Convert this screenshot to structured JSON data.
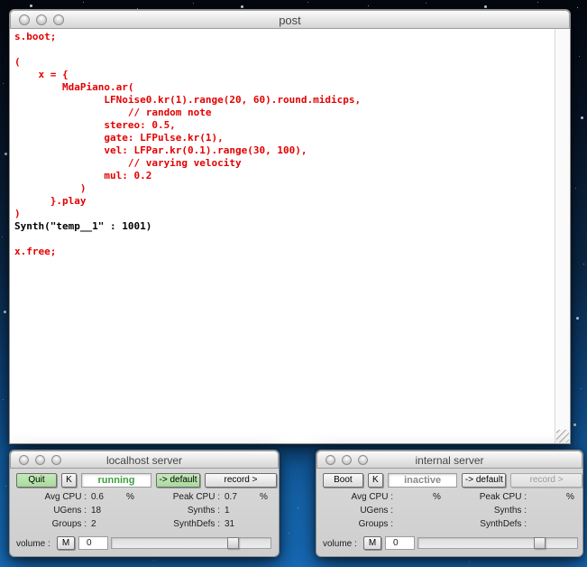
{
  "post_window": {
    "title": "post",
    "code_lines": [
      {
        "text": "s.boot;"
      },
      {
        "text": ""
      },
      {
        "text": "("
      },
      {
        "text": "    x = {"
      },
      {
        "text": "        MdaPiano.ar("
      },
      {
        "text": "               LFNoise0.kr(1).range(20, 60).round.midicps,"
      },
      {
        "text": "                   // random note"
      },
      {
        "text": "               stereo: 0.5,"
      },
      {
        "text": "               gate: LFPulse.kr(1),"
      },
      {
        "text": "               vel: LFPar.kr(0.1).range(30, 100),"
      },
      {
        "text": "                   // varying velocity"
      },
      {
        "text": "               mul: 0.2"
      },
      {
        "text": "           )"
      },
      {
        "text": "      }.play"
      },
      {
        "text": ")"
      },
      {
        "text": "Synth(\"temp__1\" : 1001)"
      },
      {
        "text": ""
      },
      {
        "text": "x.free;"
      }
    ]
  },
  "localhost_server": {
    "title": "localhost server",
    "buttons": {
      "power": "Quit",
      "kill": "K",
      "status": "running",
      "default": "-> default",
      "record": "record >"
    },
    "stats": [
      {
        "l_label": "Avg CPU :",
        "l_value": "0.6",
        "l_pct": "%",
        "r_label": "Peak CPU :",
        "r_value": "0.7",
        "r_pct": "%"
      },
      {
        "l_label": "UGens :",
        "l_value": "18",
        "l_pct": "",
        "r_label": "Synths :",
        "r_value": "1",
        "r_pct": ""
      },
      {
        "l_label": "Groups :",
        "l_value": "2",
        "l_pct": "",
        "r_label": "SynthDefs :",
        "r_value": "31",
        "r_pct": ""
      }
    ],
    "volume": {
      "label": "volume :",
      "mute": "M",
      "value": "0"
    }
  },
  "internal_server": {
    "title": "internal server",
    "buttons": {
      "power": "Boot",
      "kill": "K",
      "status": "inactive",
      "default": "-> default",
      "record": "record >"
    },
    "stats": [
      {
        "l_label": "Avg CPU :",
        "l_value": "",
        "l_pct": "%",
        "r_label": "Peak CPU :",
        "r_value": "",
        "r_pct": "%"
      },
      {
        "l_label": "UGens :",
        "l_value": "",
        "l_pct": "",
        "r_label": "Synths :",
        "r_value": "",
        "r_pct": ""
      },
      {
        "l_label": "Groups :",
        "l_value": "",
        "l_pct": "",
        "r_label": "SynthDefs :",
        "r_value": "",
        "r_pct": ""
      }
    ],
    "volume": {
      "label": "volume :",
      "mute": "M",
      "value": "0"
    }
  },
  "colors": {
    "code_red": "#e30000",
    "code_black": "#000000",
    "button_green": "#a8da9c",
    "status_running_green": "#3da03d",
    "status_inactive_gray": "#8a8a8a",
    "desktop_blue_bottom": "#176cba",
    "desktop_blue_top": "#05080f"
  }
}
